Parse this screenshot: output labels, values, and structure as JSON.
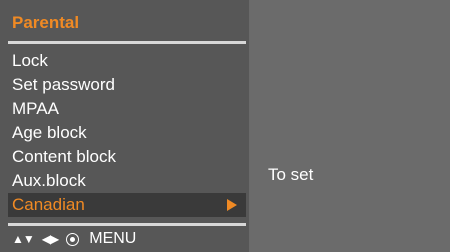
{
  "menu": {
    "title": "Parental",
    "items": [
      {
        "label": "Lock"
      },
      {
        "label": "Set password"
      },
      {
        "label": "MPAA"
      },
      {
        "label": "Age block"
      },
      {
        "label": "Content block"
      },
      {
        "label": "Aux.block"
      },
      {
        "label": "Canadian"
      }
    ],
    "selected_index": 6,
    "colors": {
      "accent": "#f08a24",
      "panel": "#575757",
      "selected_bg": "#3a3a3a"
    }
  },
  "footer": {
    "nav_updown": "▲▼",
    "nav_leftright": "◀▶",
    "menu_label": "MENU"
  },
  "detail": {
    "hint": "To set"
  }
}
